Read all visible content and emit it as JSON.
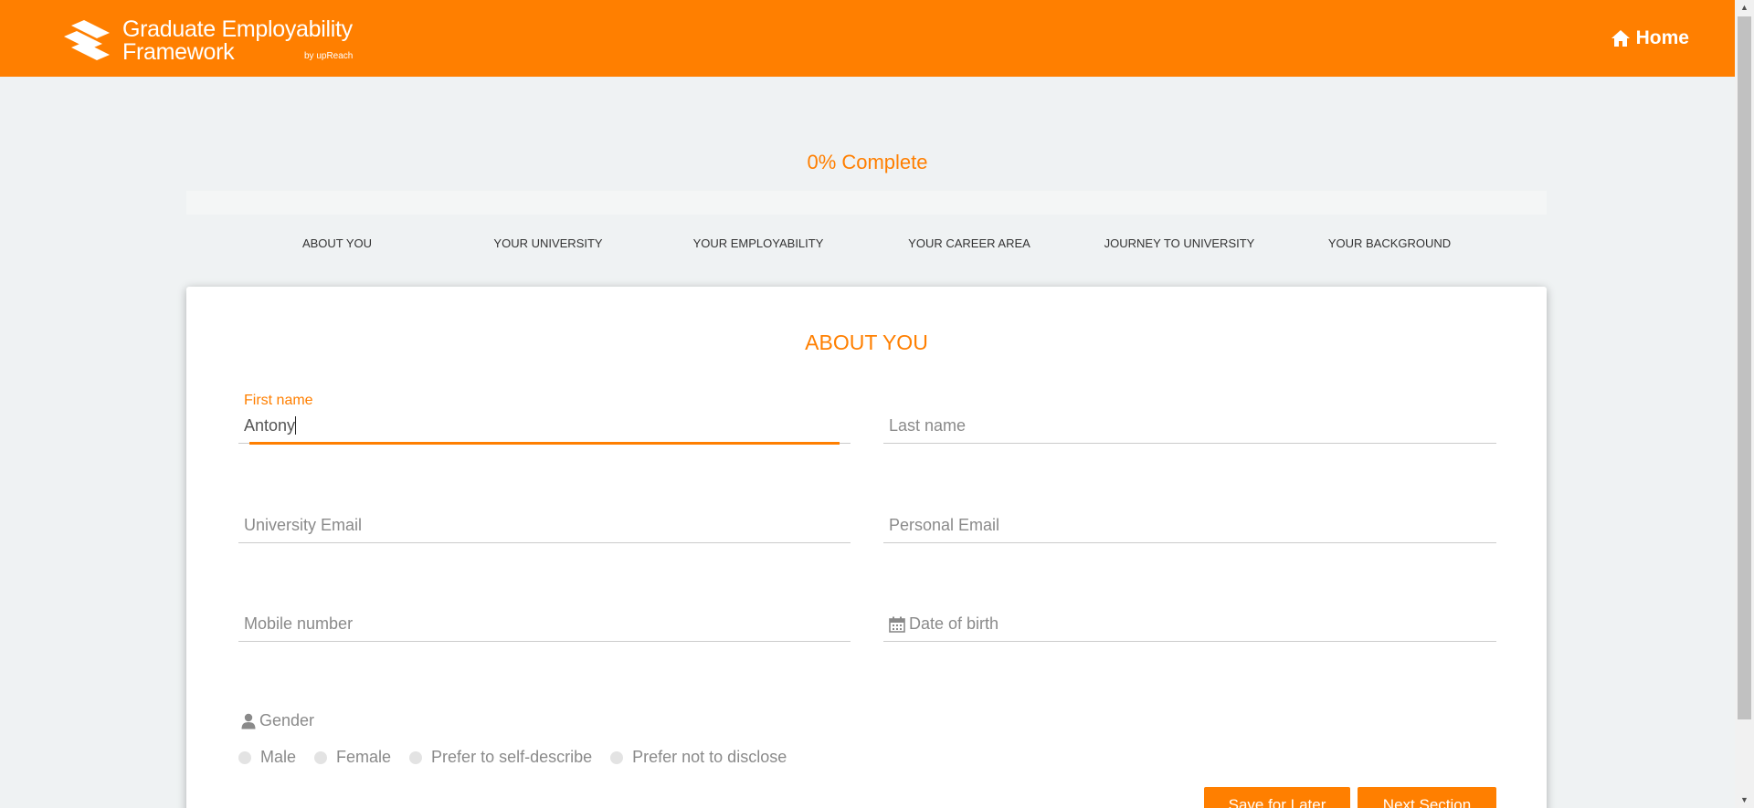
{
  "header": {
    "logo_title_line1": "Graduate Employability",
    "logo_title_line2": "Framework",
    "logo_byline": "by upReach",
    "home_label": "Home"
  },
  "progress": {
    "label": "0% Complete",
    "percent": 0
  },
  "steps": [
    {
      "label": "ABOUT YOU"
    },
    {
      "label": "YOUR UNIVERSITY"
    },
    {
      "label": "YOUR EMPLOYABILITY"
    },
    {
      "label": "YOUR CAREER AREA"
    },
    {
      "label": "JOURNEY TO UNIVERSITY"
    },
    {
      "label": "YOUR BACKGROUND"
    }
  ],
  "form": {
    "title": "ABOUT YOU",
    "first_name": {
      "label": "First name",
      "value": "Antony"
    },
    "last_name": {
      "placeholder": "Last name"
    },
    "university_email": {
      "placeholder": "University Email"
    },
    "personal_email": {
      "placeholder": "Personal Email"
    },
    "mobile_number": {
      "placeholder": "Mobile number"
    },
    "date_of_birth": {
      "placeholder": "Date of birth"
    },
    "gender": {
      "label": "Gender",
      "options": [
        "Male",
        "Female",
        "Prefer to self-describe",
        "Prefer not to disclose"
      ]
    },
    "buttons": {
      "save_later": "Save for Later",
      "next_section": "Next Section"
    }
  },
  "colors": {
    "brand": "#ff7f00",
    "page_background": "#eff2f3"
  },
  "icons": {
    "home": "home-icon",
    "calendar": "calendar-icon",
    "user": "user-icon"
  }
}
